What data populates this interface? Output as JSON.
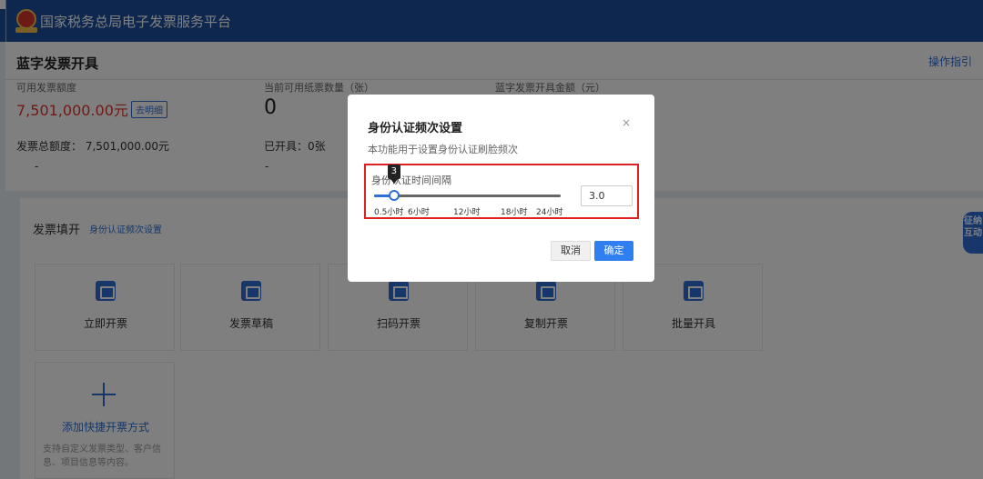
{
  "header": {
    "title": "国家税务总局电子发票服务平台",
    "logo_icon": "tax-emblem-icon"
  },
  "page": {
    "title": "蓝字发票开具",
    "guide_label": "操作指引"
  },
  "stats": {
    "quota_label": "可用发票额度",
    "quota_value": "7,501,000.00元",
    "detail_link": "去明细",
    "total_quota_label": "发票总额度：",
    "total_quota_value": "7,501,000.00元",
    "total_quota_dash": "-",
    "paper_label": "当前可用纸票数量（张）",
    "paper_value": "0",
    "issued_label": "已开具：",
    "issued_value": "0张",
    "issued_dash": "-",
    "amount_label": "蓝字发票开具金额（元）"
  },
  "issue": {
    "section_title": "发票填开",
    "section_link": "身份认证频次设置",
    "cards": [
      {
        "label": "立即开票",
        "icon": "invoice-icon"
      },
      {
        "label": "发票草稿",
        "icon": "draft-icon"
      },
      {
        "label": "扫码开票",
        "icon": "qr-code-icon"
      },
      {
        "label": "复制开票",
        "icon": "copy-invoice-icon"
      },
      {
        "label": "批量开具",
        "icon": "batch-invoice-icon"
      }
    ],
    "add_label": "添加快捷开票方式",
    "add_desc": "支持自定义发票类型、客户信息、项目信息等内容。",
    "add_icon": "plus-icon"
  },
  "float_widget": {
    "text": "征纳互动"
  },
  "modal": {
    "title": "身份认证频次设置",
    "close_icon": "×",
    "description": "本功能用于设置身份认证刷脸频次",
    "field_label": "身份认证时间间隔",
    "slider_value": 3,
    "slider_tip": "3",
    "slider_min": 0.5,
    "slider_max": 24,
    "ticks": [
      "0.5小时",
      "6小时",
      "12小时",
      "18小时",
      "24小时"
    ],
    "input_value": "3.0",
    "cancel_label": "取消",
    "ok_label": "确定",
    "accent_color": "#2f7ff0",
    "highlight_color": "#e02020"
  }
}
